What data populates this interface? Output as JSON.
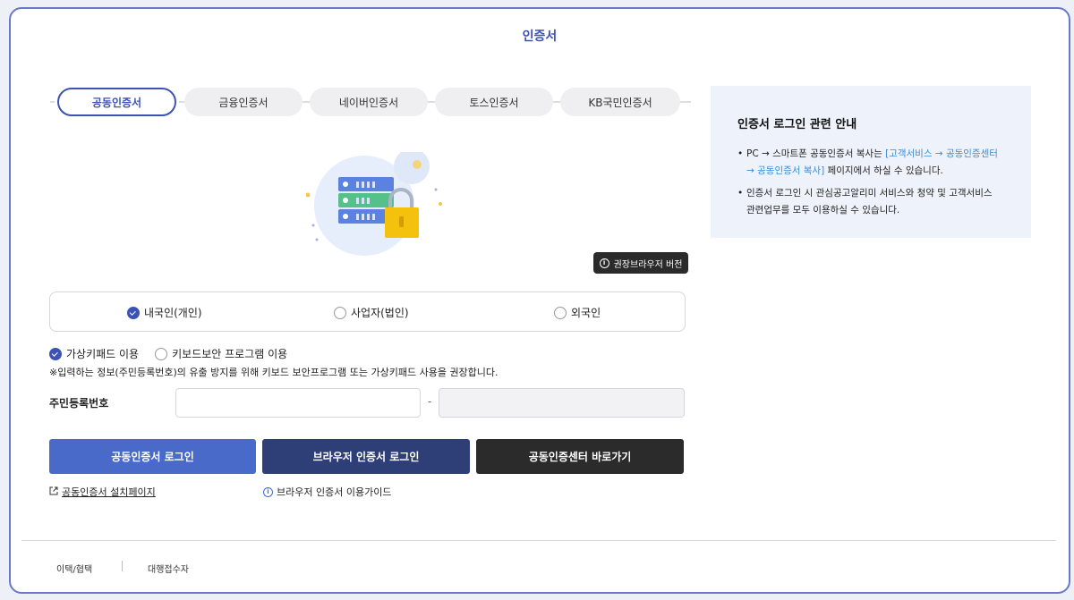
{
  "page": {
    "title": "인증서"
  },
  "tabs": [
    {
      "label": "공동인증서",
      "active": true
    },
    {
      "label": "금융인증서",
      "active": false
    },
    {
      "label": "네이버인증서",
      "active": false
    },
    {
      "label": "토스인증서",
      "active": false
    },
    {
      "label": "KB국민인증서",
      "active": false
    }
  ],
  "browser_version_button": {
    "label": "권장브라우저 버전"
  },
  "user_type": {
    "options": [
      {
        "label": "내국인(개인)",
        "selected": true
      },
      {
        "label": "사업자(법인)",
        "selected": false
      },
      {
        "label": "외국인",
        "selected": false
      }
    ]
  },
  "keyboard_options": {
    "options": [
      {
        "label": "가상키패드 이용",
        "selected": true
      },
      {
        "label": "키보드보안 프로그램 이용",
        "selected": false
      }
    ],
    "notice": "※입력하는 정보(주민등록번호)의 유출 방지를 위해 키보드 보안프로그램 또는 가상키패드 사용을 권장합니다."
  },
  "rrn": {
    "label": "주민등록번호",
    "separator": "-",
    "front_value": "",
    "back_value": ""
  },
  "actions": {
    "login": "공동인증서 로그인",
    "browser_login": "브라우저 인증서 로그인",
    "center": "공동인증센터 바로가기"
  },
  "links": {
    "install": "공동인증서 설치페이지",
    "guide": "브라우저 인증서 이용가이드"
  },
  "info_box": {
    "title": "인증서 로그인 관련 안내",
    "item1_prefix": "PC → 스마트폰 공동인증서 복사는 ",
    "item1_highlight_a": "[고객서비스 → 공동인증센터",
    "item1_highlight_b": "→ 공동인증서 복사]",
    "item1_suffix": " 페이지에서 하실 수 있습니다.",
    "item2_line1": "인증서 로그인 시 관심공고알리미 서비스와 청약 및 고객서비스",
    "item2_line2": "관련업무를 모두 이용하실 수 있습니다."
  },
  "footer": {
    "links": [
      "이택/협택",
      "대행접수자"
    ]
  },
  "colors": {
    "primary": "#3d52b5",
    "login_button": "#4a6ac9",
    "browser_login_button": "#2e3f77",
    "center_button": "#2b2b2b",
    "info_box_bg": "#eef3fb",
    "highlight": "#3a8bd8"
  },
  "icons": {
    "certificate_illustration": "server-lock-illustration",
    "info": "info-icon",
    "external_link": "external-link-icon"
  }
}
